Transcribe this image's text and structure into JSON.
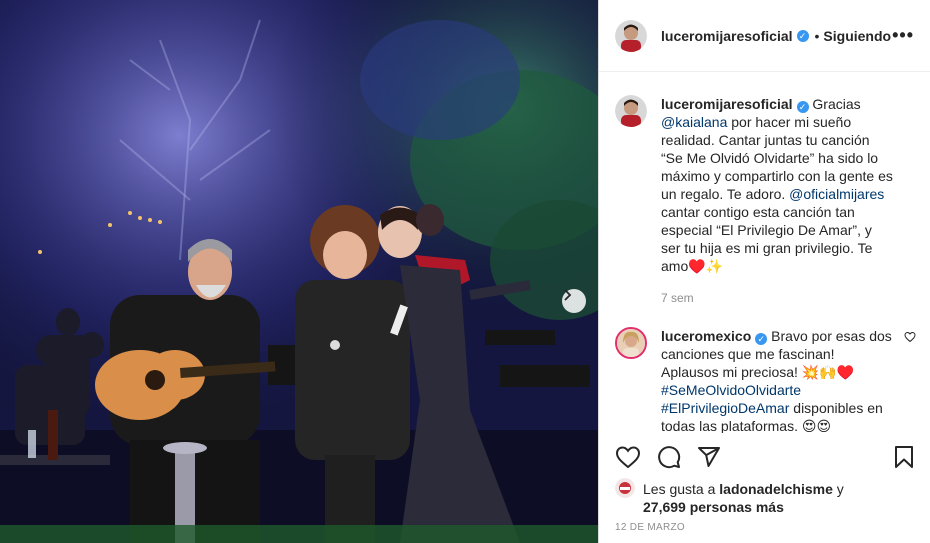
{
  "post": {
    "author": "luceromijaresoficial",
    "separator": "•",
    "follow_status": "Siguiendo",
    "more": "•••"
  },
  "caption": {
    "author": "luceromijaresoficial",
    "t1": " Gracias ",
    "m1": "@kaialana",
    "t2": " por hacer mi sueño realidad. Cantar juntas tu canción “Se Me Olvidó Olvidarte” ha sido lo máximo y compartirlo con la gente es un regalo. Te adoro. ",
    "m2": "@oficialmijares",
    "t3": " cantar contigo esta canción tan especial “El Privilegio De Amar”, y ser tu hija es mi gran privilegio. Te amo♥️✨",
    "time": "7 sem"
  },
  "comment1": {
    "author": "luceromexico",
    "t1": " Bravo por esas dos canciones que me fascinan! Aplausos mi preciosa! 💥🙌♥️ ",
    "h1": "#SeMeOlvidoOlvidarte",
    "h2": "#ElPrivilegioDeAmar",
    "t2": " disponibles en todas las plataformas. 😍😍"
  },
  "likes": {
    "prefix": "Les gusta a ",
    "user": "ladonadelchisme",
    "mid": " y ",
    "count": "27,699 personas más"
  },
  "date": "12 DE MARZO",
  "colors": {
    "link": "#00376b",
    "verified": "#3897f0",
    "meta": "#8e8e8e"
  },
  "icons": [
    "verified-badge-icon",
    "more-options-icon",
    "heart-icon",
    "comment-icon",
    "share-icon",
    "bookmark-icon",
    "carousel-next-icon"
  ]
}
